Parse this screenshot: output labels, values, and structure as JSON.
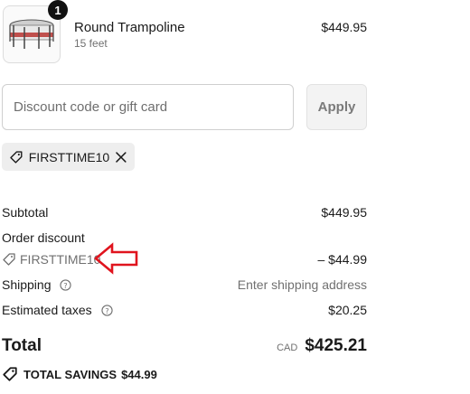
{
  "product": {
    "quantity": "1",
    "name": "Round Trampoline",
    "variant": "15 feet",
    "price": "$449.95"
  },
  "discount": {
    "placeholder": "Discount code or gift card",
    "apply_label": "Apply",
    "applied_code": "FIRSTTIME10"
  },
  "summary": {
    "subtotal_label": "Subtotal",
    "subtotal_value": "$449.95",
    "order_discount_label": "Order discount",
    "discount_code": "FIRSTTIME10",
    "discount_value": "– $44.99",
    "shipping_label": "Shipping",
    "shipping_value": "Enter shipping address",
    "taxes_label": "Estimated taxes",
    "taxes_value": "$20.25",
    "total_label": "Total",
    "currency": "CAD",
    "total_value": "$425.21",
    "savings_label": "TOTAL SAVINGS",
    "savings_value": "$44.99"
  },
  "colors": {
    "annotation_arrow": "#e0141e"
  }
}
